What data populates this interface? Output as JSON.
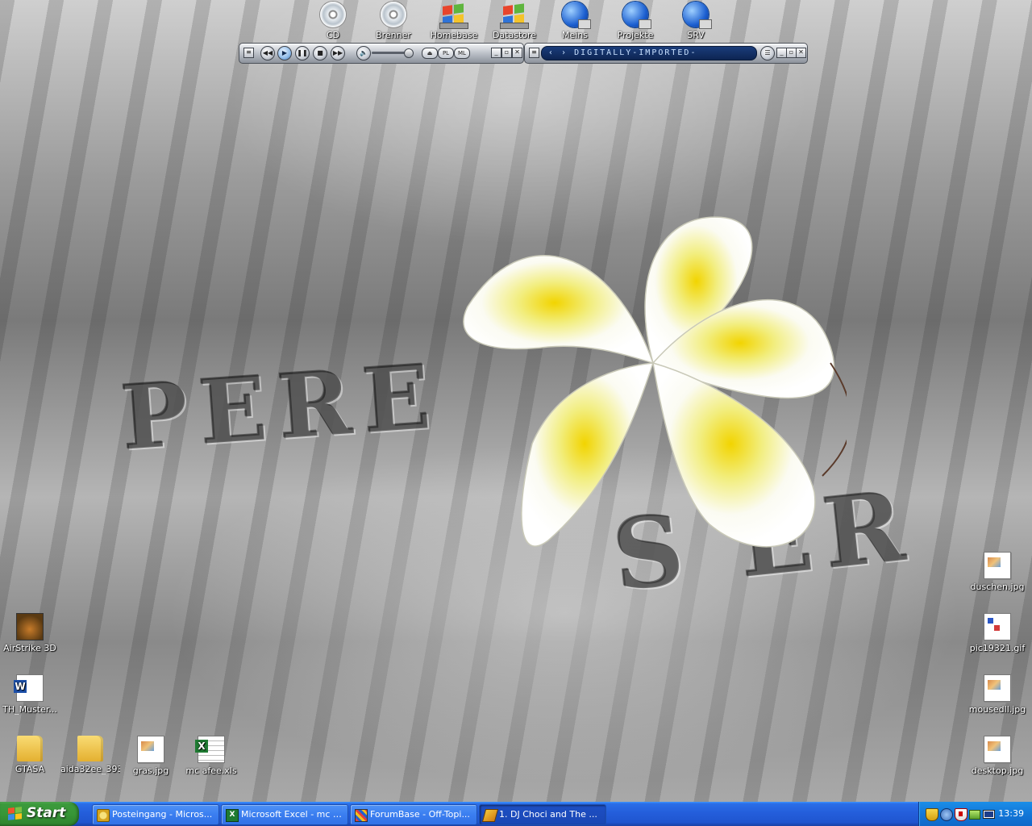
{
  "top_icons": [
    {
      "label": "CD",
      "icon": "cd-icon"
    },
    {
      "label": "Brenner",
      "icon": "cd-icon"
    },
    {
      "label": "Homebase",
      "icon": "network-drive-icon"
    },
    {
      "label": "Datastore",
      "icon": "network-drive-icon"
    },
    {
      "label": "Meins",
      "icon": "network-globe-icon"
    },
    {
      "label": "Projekte",
      "icon": "network-globe-icon"
    },
    {
      "label": "SRV",
      "icon": "network-globe-icon"
    }
  ],
  "left_icons": [
    {
      "label": "AirStrike 3D",
      "icon": "game-icon"
    },
    {
      "label": "TH_Muster...",
      "icon": "word-document-icon"
    }
  ],
  "bottom_icons": [
    {
      "label": "GTASA",
      "icon": "folder-icon"
    },
    {
      "label": "aida32ee_393",
      "icon": "folder-icon"
    },
    {
      "label": "gras.jpg",
      "icon": "image-file-icon"
    },
    {
      "label": "mc afee.xls",
      "icon": "excel-file-icon"
    }
  ],
  "right_icons": [
    {
      "label": "duschen.jpg",
      "icon": "image-file-icon"
    },
    {
      "label": "pic19321.gif",
      "icon": "gif-file-icon"
    },
    {
      "label": "mousedll.jpg",
      "icon": "image-file-icon"
    },
    {
      "label": "desktop.jpg",
      "icon": "image-file-icon"
    }
  ],
  "winamp": {
    "pl_label": "PL",
    "ml_label": "ML",
    "display_text": "‹ › DIGITALLY-IMPORTED-"
  },
  "wallpaper_letters": [
    "PERE",
    "S  ER"
  ],
  "taskbar": {
    "start_label": "Start",
    "tasks": [
      {
        "label": "Posteingang - Micros...",
        "icon": "outlook-icon"
      },
      {
        "label": "Microsoft Excel - mc a...",
        "icon": "excel-icon"
      },
      {
        "label": "ForumBase - Off-Topi...",
        "icon": "forumbase-icon"
      },
      {
        "label": "1. DJ Choci and The ...",
        "icon": "winamp-icon"
      }
    ],
    "clock": "13:39"
  },
  "colors": {
    "taskbar_blue": "#245edb",
    "start_green": "#379637",
    "tray_blue": "#1277d8"
  }
}
